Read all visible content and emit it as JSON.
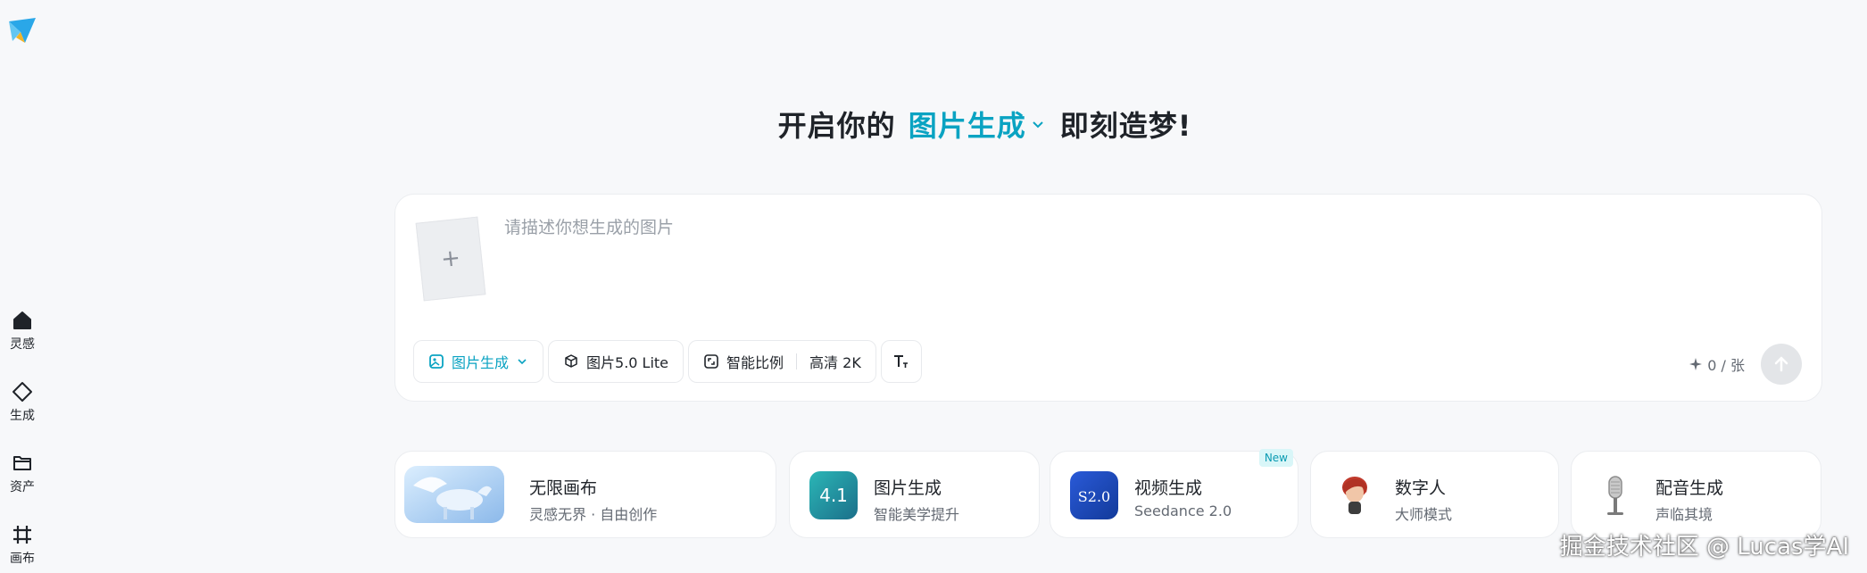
{
  "sidebar": {
    "items": [
      {
        "label": "灵感",
        "icon": "home-icon"
      },
      {
        "label": "生成",
        "icon": "diamond-icon"
      },
      {
        "label": "资产",
        "icon": "folder-icon"
      },
      {
        "label": "画布",
        "icon": "canvas-grid-icon"
      }
    ]
  },
  "headline": {
    "prefix": "开启你的",
    "mode": "图片生成",
    "suffix": "即刻造梦!"
  },
  "prompt": {
    "placeholder": "请描述你想生成的图片",
    "value": "",
    "upload_symbol": "+"
  },
  "toolbar": {
    "mode_label": "图片生成",
    "model_label": "图片5.0 Lite",
    "ratio_label": "智能比例",
    "quality_label": "高清 2K",
    "text_icon_label": "T"
  },
  "credits": {
    "text": "0 / 张"
  },
  "features": [
    {
      "title": "无限画布",
      "subtitle": "灵感无界 · 自由创作"
    },
    {
      "title": "图片生成",
      "subtitle": "智能美学提升",
      "thumb_text": "4.1"
    },
    {
      "title": "视频生成",
      "subtitle": "Seedance 2.0",
      "badge": "New",
      "thumb_text": "S2.0"
    },
    {
      "title": "数字人",
      "subtitle": "大师模式"
    },
    {
      "title": "配音生成",
      "subtitle": "声临其境"
    }
  ],
  "watermark": "掘金技术社区 @ Lucas学AI",
  "colors": {
    "accent": "#0aa3c2",
    "background": "#f7f8fa"
  }
}
